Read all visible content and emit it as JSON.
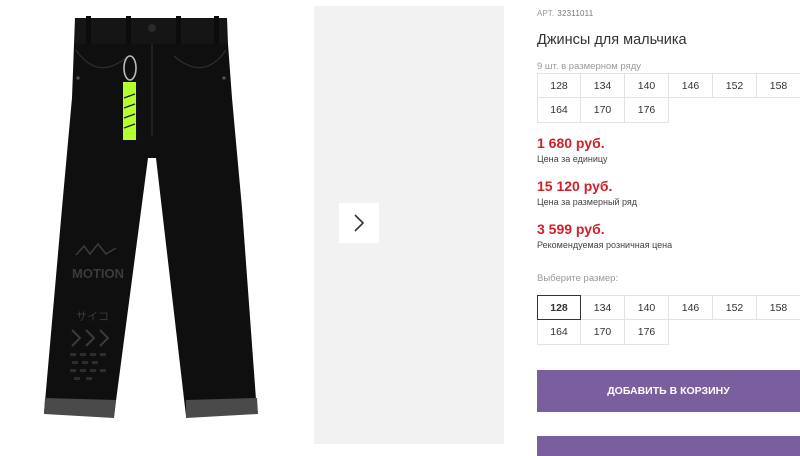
{
  "product": {
    "sku_label": "АРТ.",
    "sku": "32311011",
    "title": "Джинсы для мальчика",
    "pack_note": "9 шт. в размерном ряду",
    "pack_sizes": [
      "128",
      "134",
      "140",
      "146",
      "152",
      "158",
      "164",
      "170",
      "176"
    ]
  },
  "prices": [
    {
      "value": "1 680 руб.",
      "label": "Цена за единицу"
    },
    {
      "value": "15 120 руб.",
      "label": "Цена за размерный ряд"
    },
    {
      "value": "3 599 руб.",
      "label": "Рекомендуемая розничная цена"
    }
  ],
  "size_select": {
    "label": "Выберите размер:",
    "options": [
      "128",
      "134",
      "140",
      "146",
      "152",
      "158",
      "164",
      "170",
      "176"
    ],
    "selected": "128"
  },
  "actions": {
    "add_to_cart": "ДОБАВИТЬ В КОРЗИНУ"
  },
  "image_print": {
    "motion_text": "MOTION",
    "kana_text": "サイコ"
  },
  "icons": {
    "next": "chevron-right-icon"
  },
  "colors": {
    "price": "#d0202a",
    "button": "#7b5e9e",
    "tag": "#b6ff2e"
  }
}
